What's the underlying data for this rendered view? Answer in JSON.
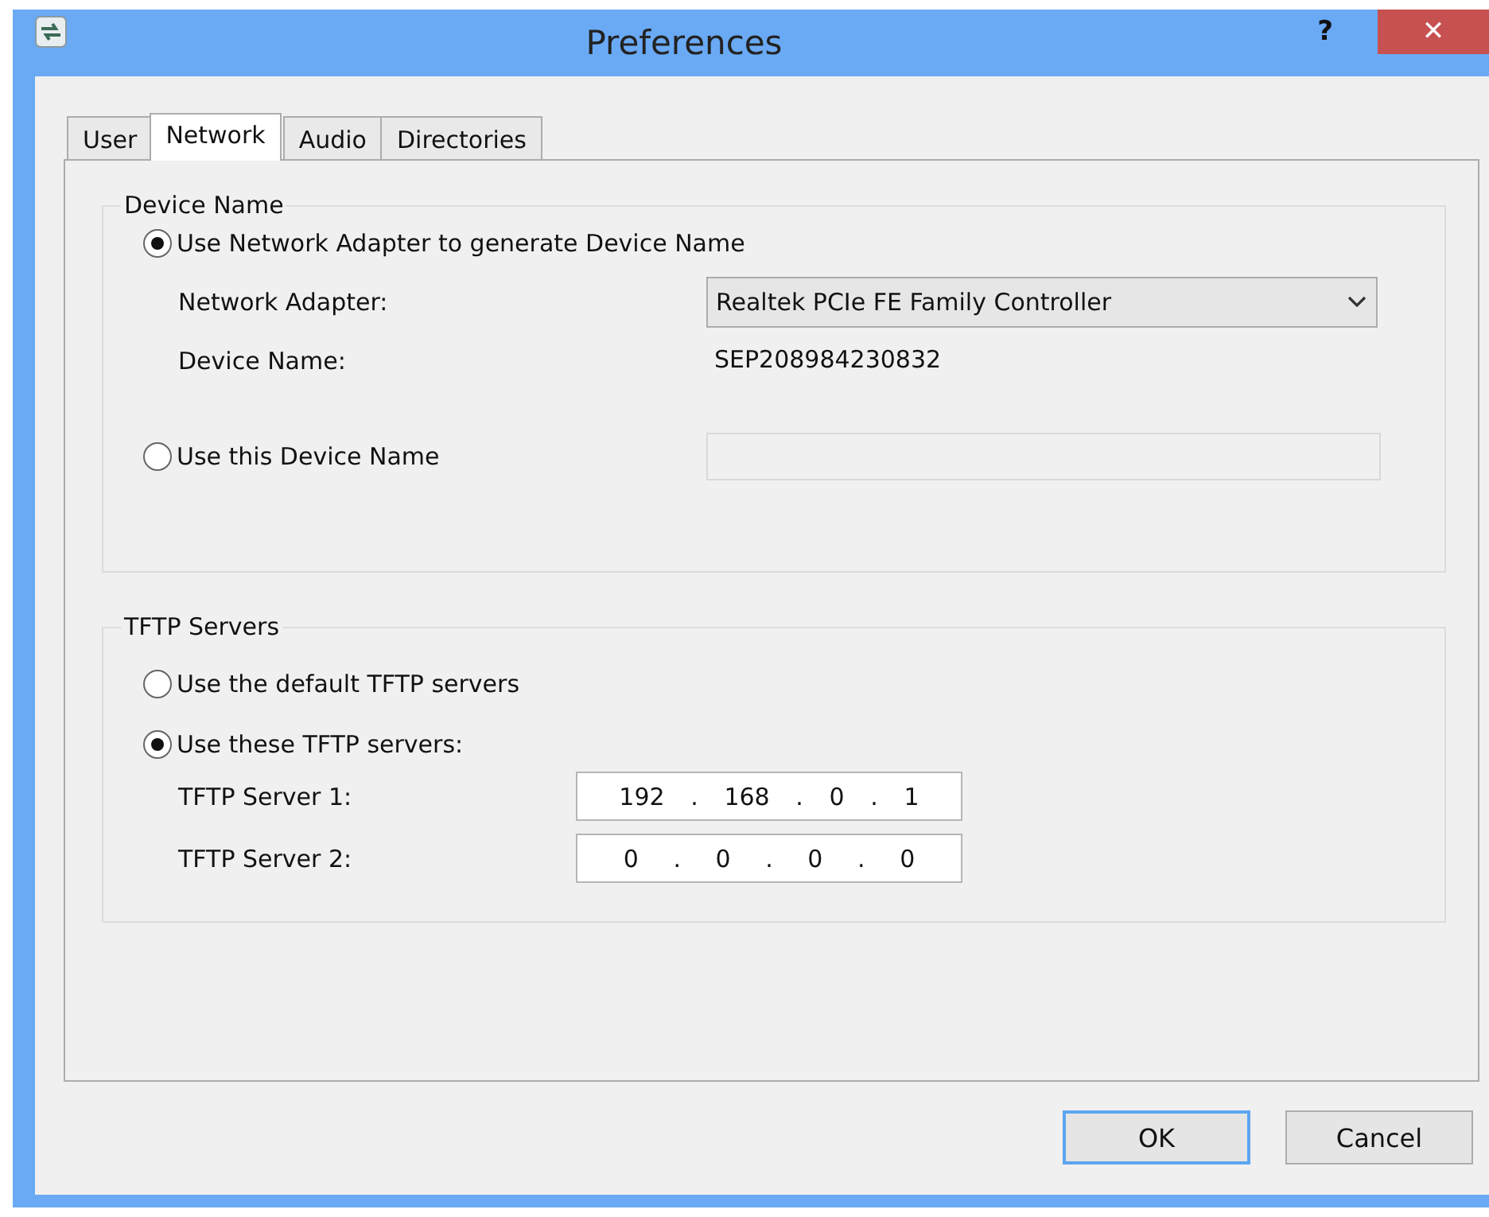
{
  "window": {
    "title": "Preferences",
    "help": "?",
    "close": "✕"
  },
  "tabs": [
    {
      "label": "User",
      "selected": false
    },
    {
      "label": "Network",
      "selected": true
    },
    {
      "label": "Audio",
      "selected": false
    },
    {
      "label": "Directories",
      "selected": false
    }
  ],
  "device_name": {
    "title": "Device Name",
    "use_adapter": {
      "label": "Use Network Adapter to generate Device Name",
      "selected": true
    },
    "adapter_label": "Network Adapter:",
    "adapter_value": "Realtek PCIe FE Family Controller",
    "name_label": "Device Name:",
    "name_value": "SEP208984230832",
    "use_custom": {
      "label": "Use this Device Name",
      "selected": false
    }
  },
  "tftp": {
    "title": "TFTP Servers",
    "use_default": {
      "label": "Use the default TFTP servers",
      "selected": false
    },
    "use_these": {
      "label": "Use these TFTP servers:",
      "selected": true
    },
    "servers": [
      {
        "label": "TFTP Server 1:",
        "parts": [
          "192",
          ".",
          "168",
          ".",
          "0",
          ".",
          "1"
        ]
      },
      {
        "label": "TFTP Server 2:",
        "parts": [
          "0",
          ".",
          "0",
          ".",
          "0",
          ".",
          "0"
        ]
      }
    ]
  },
  "buttons": [
    {
      "label": "OK",
      "default": true
    },
    {
      "label": "Cancel",
      "default": false
    }
  ]
}
